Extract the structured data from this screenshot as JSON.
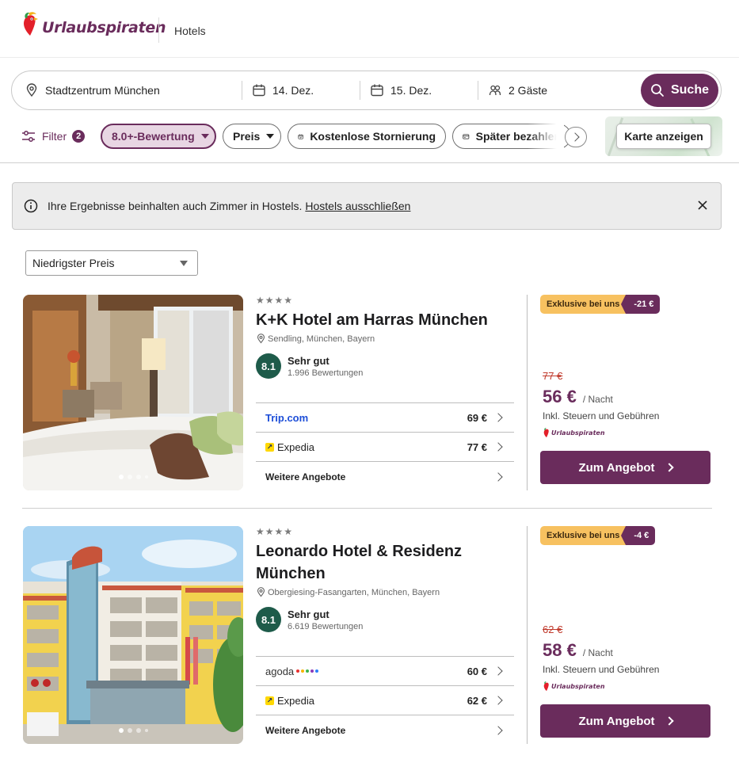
{
  "brand": {
    "name": "Urlaubspiraten",
    "color": "#6a2c5c"
  },
  "header": {
    "nav_item": "Hotels"
  },
  "search": {
    "destination": "Stadtzentrum München",
    "checkin": "14. Dez.",
    "checkout": "15. Dez.",
    "guests": "2 Gäste",
    "button": "Suche"
  },
  "filters": {
    "filter_label": "Filter",
    "filter_count": "2",
    "chips": [
      "8.0+-Bewertung",
      "Preis",
      "Kostenlose Stornierung",
      "Später bezahlen"
    ],
    "map_button": "Karte anzeigen"
  },
  "banner": {
    "text": "Ihre Ergebnisse beinhalten auch Zimmer in Hostels.",
    "link": "Hostels ausschließen"
  },
  "sort": {
    "selected": "Niedrigster Preis"
  },
  "hotels": [
    {
      "stars": "★★★★",
      "name": "K+K Hotel am Harras München",
      "location": "Sendling, München, Bayern",
      "rating": "8.1",
      "rating_label": "Sehr gut",
      "reviews": "1.996 Bewertungen",
      "offers": [
        {
          "provider": "Trip.com",
          "price": "69 €"
        },
        {
          "provider": "Expedia",
          "price": "77 €"
        },
        {
          "provider": "Weitere Angebote",
          "price": ""
        }
      ],
      "exclusive_label": "Exklusive bei uns",
      "discount": "-21 €",
      "old_price": "77 €",
      "price": "56 €",
      "per_night": "/ Nacht",
      "tax_note": "Inkl. Steuern und Gebühren",
      "cta": "Zum Angebot"
    },
    {
      "stars": "★★★★",
      "name": "Leonardo Hotel & Residenz München",
      "location": "Obergiesing-Fasangarten, München, Bayern",
      "rating": "8.1",
      "rating_label": "Sehr gut",
      "reviews": "6.619 Bewertungen",
      "offers": [
        {
          "provider": "agoda",
          "price": "60 €"
        },
        {
          "provider": "Expedia",
          "price": "62 €"
        },
        {
          "provider": "Weitere Angebote",
          "price": ""
        }
      ],
      "exclusive_label": "Exklusive bei uns",
      "discount": "-4 €",
      "old_price": "62 €",
      "price": "58 €",
      "per_night": "/ Nacht",
      "tax_note": "Inkl. Steuern und Gebühren",
      "cta": "Zum Angebot"
    }
  ]
}
